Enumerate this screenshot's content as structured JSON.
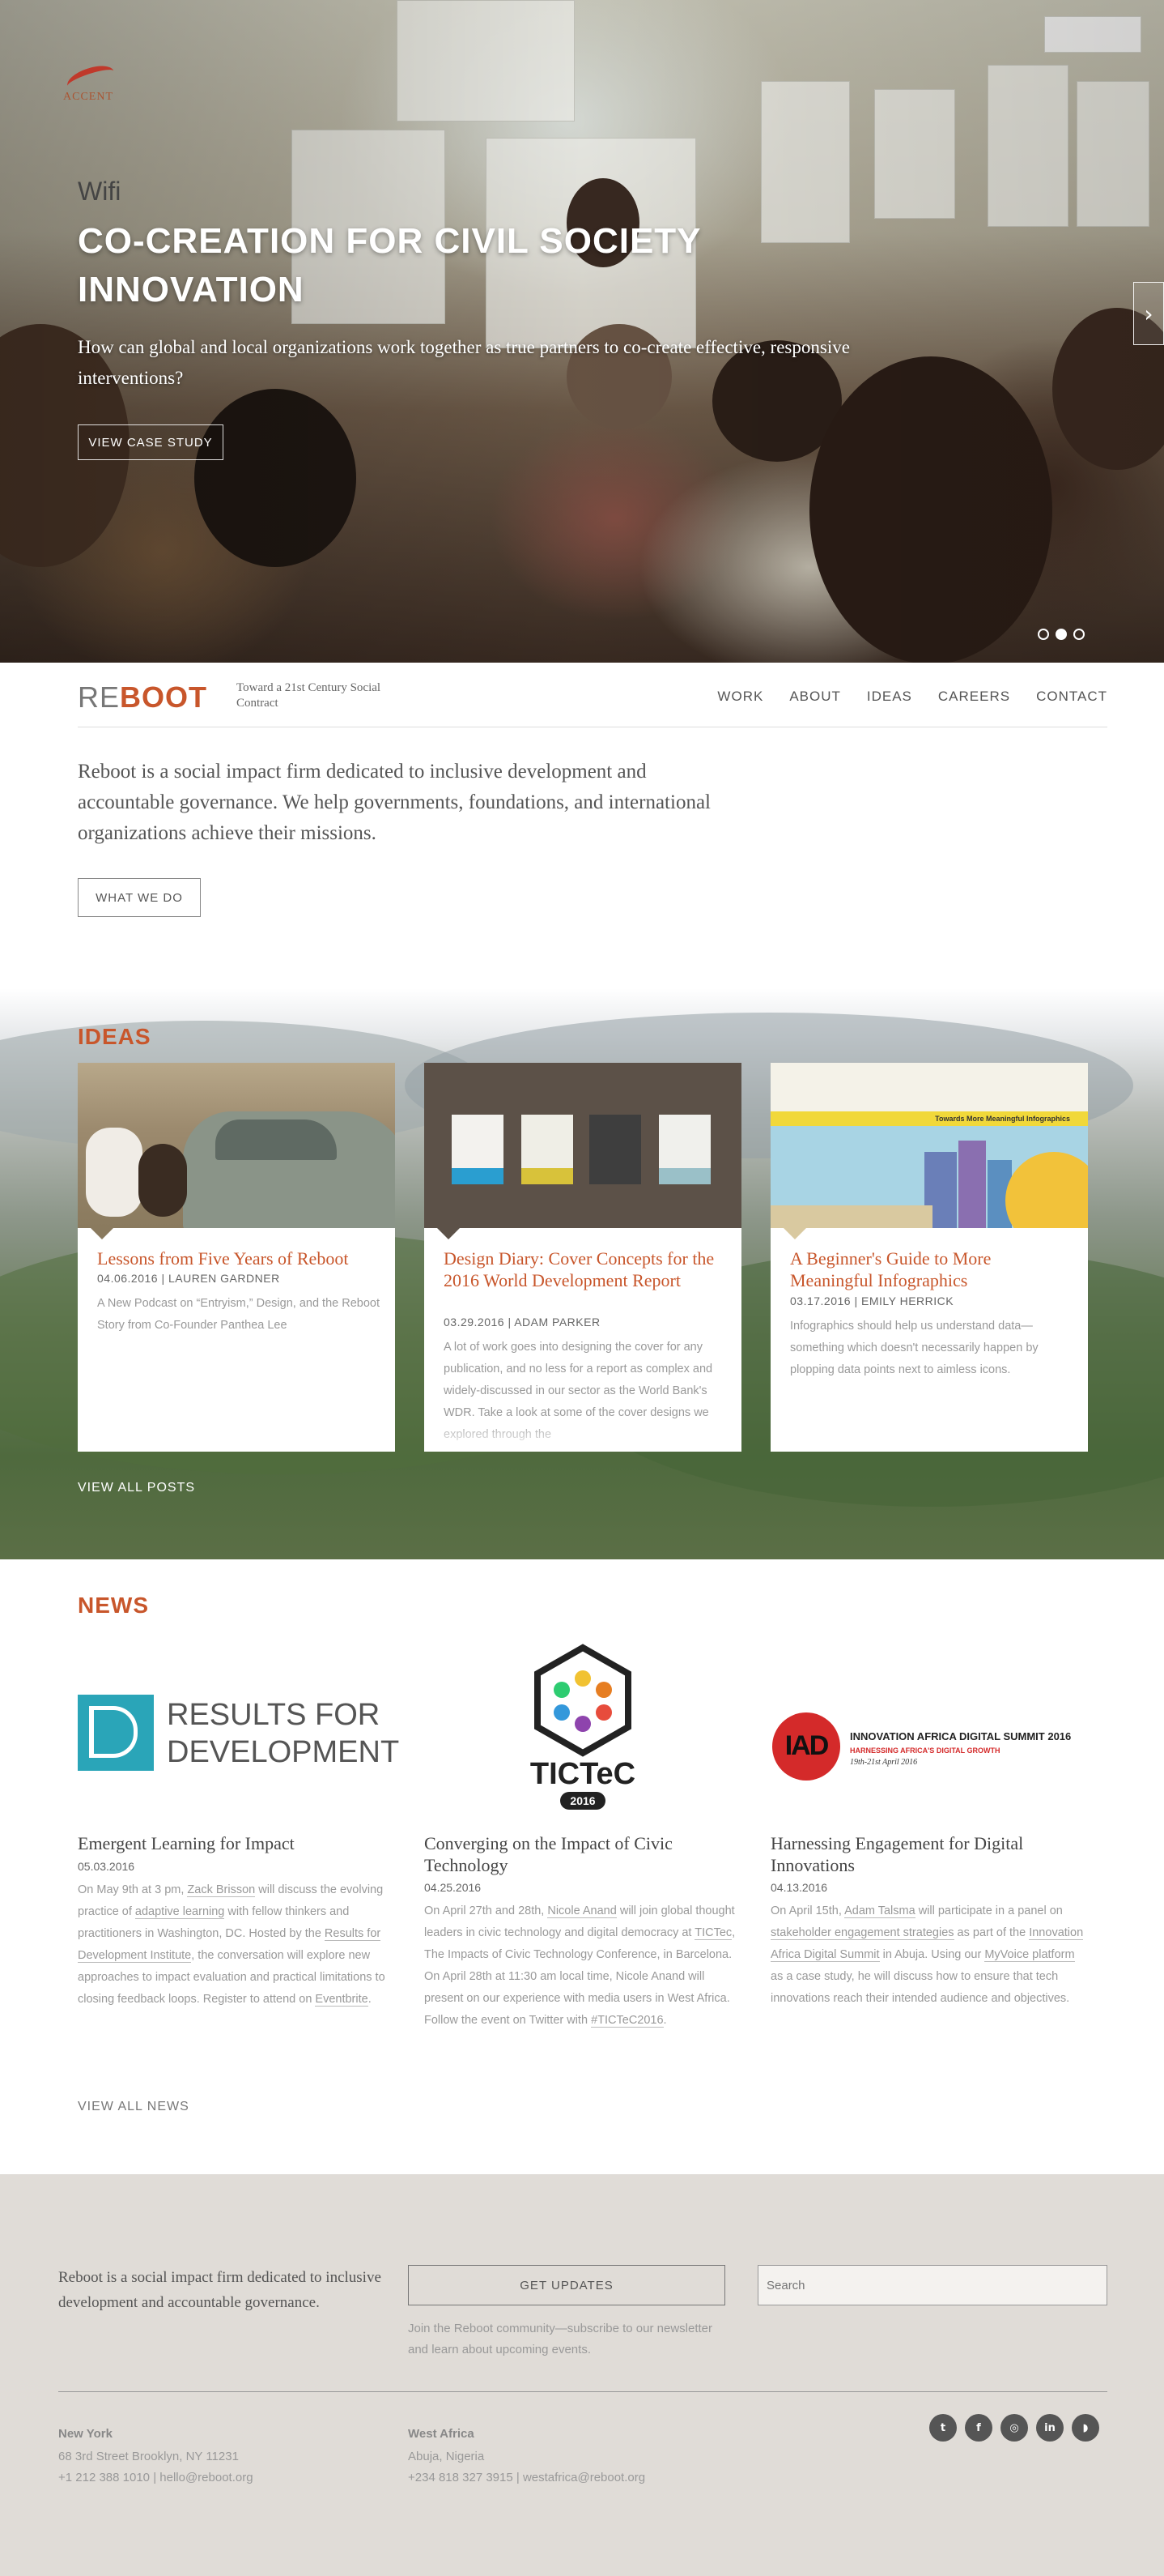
{
  "hero": {
    "logo_text": "ACCENT",
    "wifi_text": "Wifi",
    "title": "CO-CREATION FOR CIVIL SOCIETY INNOVATION",
    "subtitle": "How can global and local organizations work together as true partners to co-create effective, responsive interventions?",
    "button_label": "VIEW CASE STUDY",
    "next_glyph": "›",
    "slides": 3,
    "active_slide": 2
  },
  "header": {
    "logo_re": "RE",
    "logo_boot": "BOOT",
    "tagline": "Toward a 21st Century Social Contract",
    "nav": [
      "WORK",
      "ABOUT",
      "IDEAS",
      "CAREERS",
      "CONTACT"
    ]
  },
  "intro": {
    "text": "Reboot is a social impact firm dedicated to inclusive development and accountable governance. We help governments, foundations, and international organizations achieve their missions.",
    "button_label": "WHAT WE DO"
  },
  "ideas": {
    "title": "IDEAS",
    "cards": [
      {
        "title": "Lessons from Five Years of Reboot",
        "meta": "04.06.2016 | LAUREN GARDNER",
        "text": "A New Podcast on “Entryism,” Design, and the Reboot Story from Co-Founder Panthea Lee"
      },
      {
        "title": "Design Diary: Cover Concepts for the 2016 World Development Report",
        "meta": "03.29.2016 | ADAM PARKER",
        "text": "A lot of work goes into designing the cover for any publication, and no less for a report as complex and widely-discussed in our sector as the World Bank's WDR. Take a look at some of the cover designs we explored through the"
      },
      {
        "title": "A Beginner's Guide to More Meaningful Infographics",
        "meta": "03.17.2016 | EMILY HERRICK",
        "text": "Infographics should help us understand data—something which doesn't necessarily happen by plopping data points next to aimless icons.",
        "image_caption": "Towards More Meaningful Infographics"
      }
    ],
    "view_all": "VIEW ALL POSTS"
  },
  "news": {
    "title": "NEWS",
    "logos": {
      "r4d_line1": "RESULTS FOR",
      "r4d_line2": "DEVELOPMENT",
      "tictec": "TICTeC",
      "tictec_year": "2016",
      "iad_letters": "IAD",
      "iad_title": "INNOVATION AFRICA DIGITAL SUMMIT 2016",
      "iad_sub": "HARNESSING AFRICA'S DIGITAL GROWTH",
      "iad_date": "19th-21st April 2016"
    },
    "items": [
      {
        "title": "Emergent Learning for Impact",
        "date": "05.03.2016",
        "t1": "On May 9th at 3 pm, ",
        "l1": "Zack Brisson",
        "t2": " will discuss the evolving practice of ",
        "l2": "adaptive learning",
        "t3": " with fellow thinkers and practitioners in Washington, DC. Hosted by the ",
        "l3": "Results for Development Institute",
        "t4": ", the conversation will explore new approaches to impact evaluation and practical limitations to closing feedback loops. Register to attend on ",
        "l4": "Eventbrite",
        "t5": "."
      },
      {
        "title": "Converging on the Impact of Civic Technology",
        "date": "04.25.2016",
        "t1": "On April 27th and 28th, ",
        "l1": "Nicole Anand",
        "t2": " will join global thought leaders in civic technology and digital democracy at ",
        "l2": "TICTec",
        "t3": ", The Impacts of Civic Technology Conference, in Barcelona. On April 28th at 11:30 am local time, Nicole Anand will present on our experience with media users in West Africa. Follow the event on Twitter with ",
        "l3": "#TICTeC2016",
        "t4": "."
      },
      {
        "title": "Harnessing Engagement for Digital Innovations",
        "date": "04.13.2016",
        "t1": "On April 15th, ",
        "l1": "Adam Talsma",
        "t2": " will participate in a panel on ",
        "l2": "stakeholder engagement strategies",
        "t3": " as part of the ",
        "l3": "Innovation Africa Digital Summit",
        "t4": " in Abuja. Using our ",
        "l4": "MyVoice platform",
        "t5": " as a case study, he will discuss how to ensure that tech innovations reach their intended audience and objectives."
      }
    ],
    "view_all": "VIEW ALL NEWS"
  },
  "footer": {
    "about": "Reboot is a social impact firm dedicated to inclusive development and accountable governance.",
    "updates_button": "GET UPDATES",
    "updates_text": "Join the Reboot community—subscribe to our newsletter and learn about upcoming events.",
    "search_placeholder": "Search",
    "offices": [
      {
        "name": "New York",
        "address": "68 3rd Street Brooklyn, NY 11231",
        "contact": "+1 212 388 1010  |  hello@reboot.org"
      },
      {
        "name": "West Africa",
        "address": "Abuja, Nigeria",
        "contact": "+234 818 327 3915  |  westafrica@reboot.org"
      }
    ],
    "social": [
      "twitter-icon",
      "facebook-icon",
      "instagram-icon",
      "linkedin-icon",
      "rss-icon"
    ]
  },
  "colors": {
    "brand": "#c8562b",
    "footer_bg": "#e0dcd7"
  }
}
